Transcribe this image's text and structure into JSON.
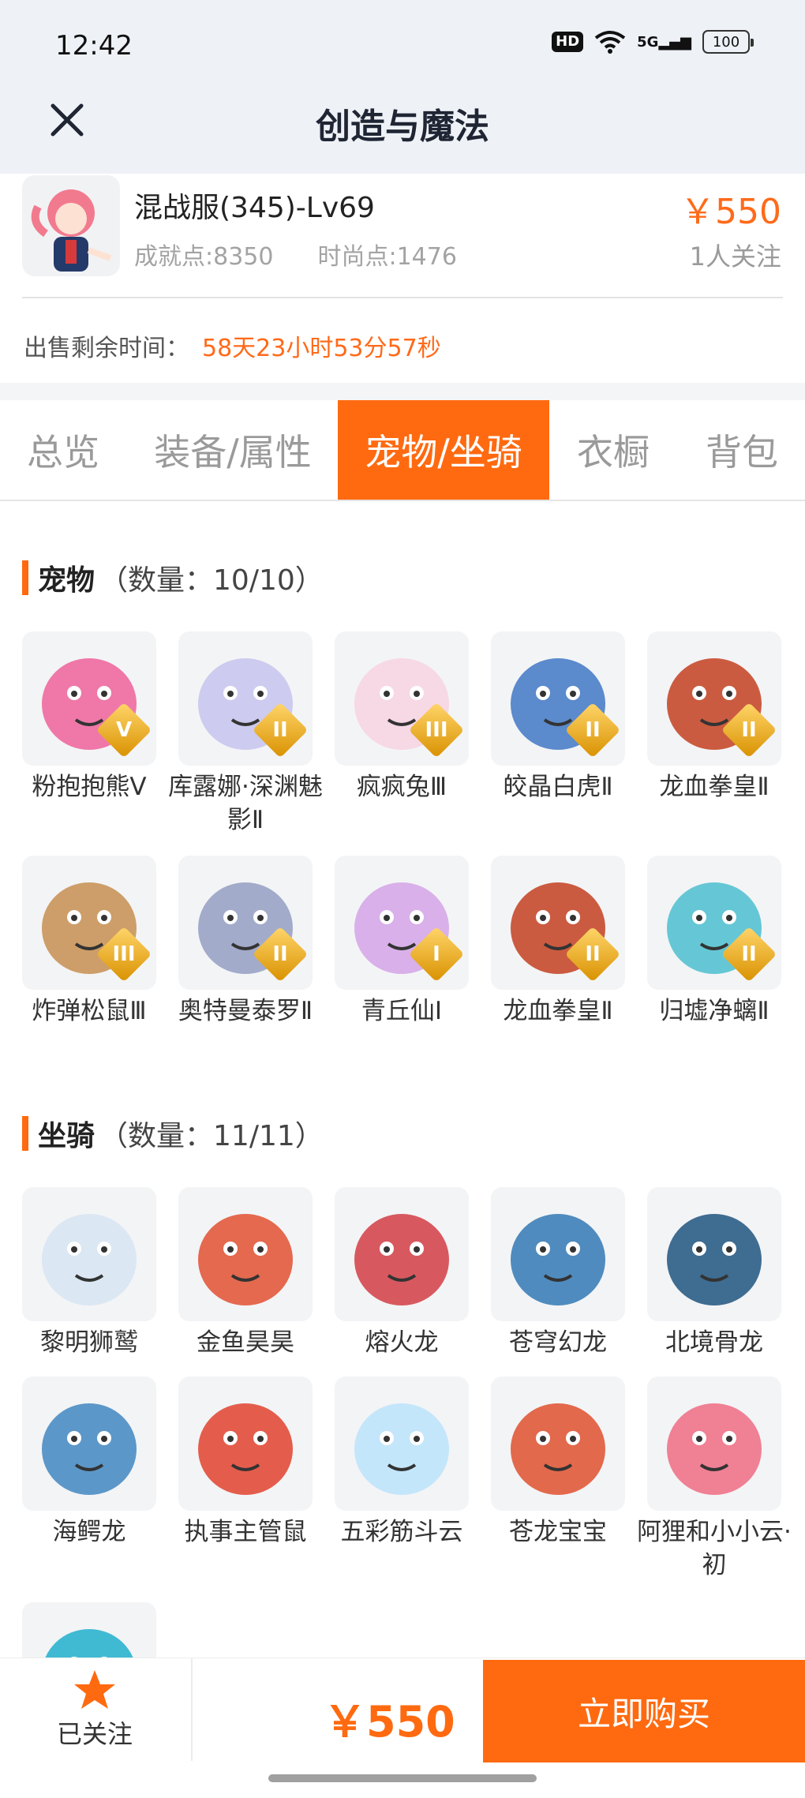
{
  "status": {
    "time": "12:42",
    "hd": "HD",
    "signal": "5G",
    "battery": "100"
  },
  "nav": {
    "title": "创造与魔法"
  },
  "profile": {
    "server": "混战服(345)-Lv69",
    "achievement": "成就点:8350",
    "fashion": "时尚点:1476",
    "price": "￥550",
    "followers": "1人关注",
    "remain_label": "出售剩余时间：",
    "remain_value": "58天23小时53分57秒"
  },
  "tabs": [
    {
      "label": "总览"
    },
    {
      "label": "装备/属性"
    },
    {
      "label": "宠物/坐骑",
      "active": true
    },
    {
      "label": "衣橱"
    },
    {
      "label": "背包"
    }
  ],
  "pets": {
    "title": "宠物",
    "count": "（数量：10/10）",
    "items": [
      {
        "label": "粉抱抱熊Ⅴ",
        "rank": "V",
        "icon": "pink-bear-icon",
        "color": "#ee6aa0"
      },
      {
        "label": "库露娜·深渊魅影Ⅱ",
        "rank": "II",
        "icon": "kuluna-icon",
        "color": "#c9c7ee"
      },
      {
        "label": "疯疯兔Ⅲ",
        "rank": "III",
        "icon": "crazy-rabbit-icon",
        "color": "#f7d5e3"
      },
      {
        "label": "皎晶白虎Ⅱ",
        "rank": "II",
        "icon": "white-tiger-icon",
        "color": "#4a7ec9"
      },
      {
        "label": "龙血拳皇Ⅱ",
        "rank": "II",
        "icon": "dragon-fist-icon",
        "color": "#c64a2c"
      },
      {
        "label": "炸弹松鼠Ⅲ",
        "rank": "III",
        "icon": "bomb-squirrel-icon",
        "color": "#c9955a"
      },
      {
        "label": "奥特曼泰罗Ⅱ",
        "rank": "II",
        "icon": "ultraman-icon",
        "color": "#9aa3c6"
      },
      {
        "label": "青丘仙Ⅰ",
        "rank": "I",
        "icon": "qingqiu-fairy-icon",
        "color": "#d6a8e8"
      },
      {
        "label": "龙血拳皇Ⅱ",
        "rank": "II",
        "icon": "dragon-fist-icon",
        "color": "#c64a2c"
      },
      {
        "label": "归墟净螭Ⅱ",
        "rank": "II",
        "icon": "guixu-dragon-icon",
        "color": "#55c2d2"
      }
    ]
  },
  "mounts": {
    "title": "坐骑",
    "count": "（数量：11/11）",
    "items": [
      {
        "label": "黎明狮鹫",
        "icon": "griffin-icon",
        "color": "#d8e6f3"
      },
      {
        "label": "金鱼昊昊",
        "icon": "goldfish-icon",
        "color": "#e25a3c"
      },
      {
        "label": "熔火龙",
        "icon": "lava-dragon-icon",
        "color": "#d4484f"
      },
      {
        "label": "苍穹幻龙",
        "icon": "sky-dragon-icon",
        "color": "#3d7fb8"
      },
      {
        "label": "北境骨龙",
        "icon": "bone-dragon-icon",
        "color": "#2b5d86"
      },
      {
        "label": "海鳄龙",
        "icon": "sea-croc-dragon-icon",
        "color": "#4b8dc4"
      },
      {
        "label": "执事主管鼠",
        "icon": "butler-rat-icon",
        "color": "#e24c3a"
      },
      {
        "label": "五彩筋斗云",
        "icon": "cloud-icon",
        "color": "#bfe4fb"
      },
      {
        "label": "苍龙宝宝",
        "icon": "baby-dragon-icon",
        "color": "#e15a3a"
      },
      {
        "label": "阿狸和小小云·初",
        "icon": "ali-cloud-icon",
        "color": "#f07389"
      },
      {
        "label": "",
        "icon": "partial-mount-icon",
        "color": "#2cb4cf"
      }
    ]
  },
  "bottom": {
    "follow_label": "已关注",
    "price": "￥550",
    "buy_label": "立即购买"
  },
  "colors": {
    "accent": "#ff6a10",
    "header_bg": "#eef2f7"
  }
}
